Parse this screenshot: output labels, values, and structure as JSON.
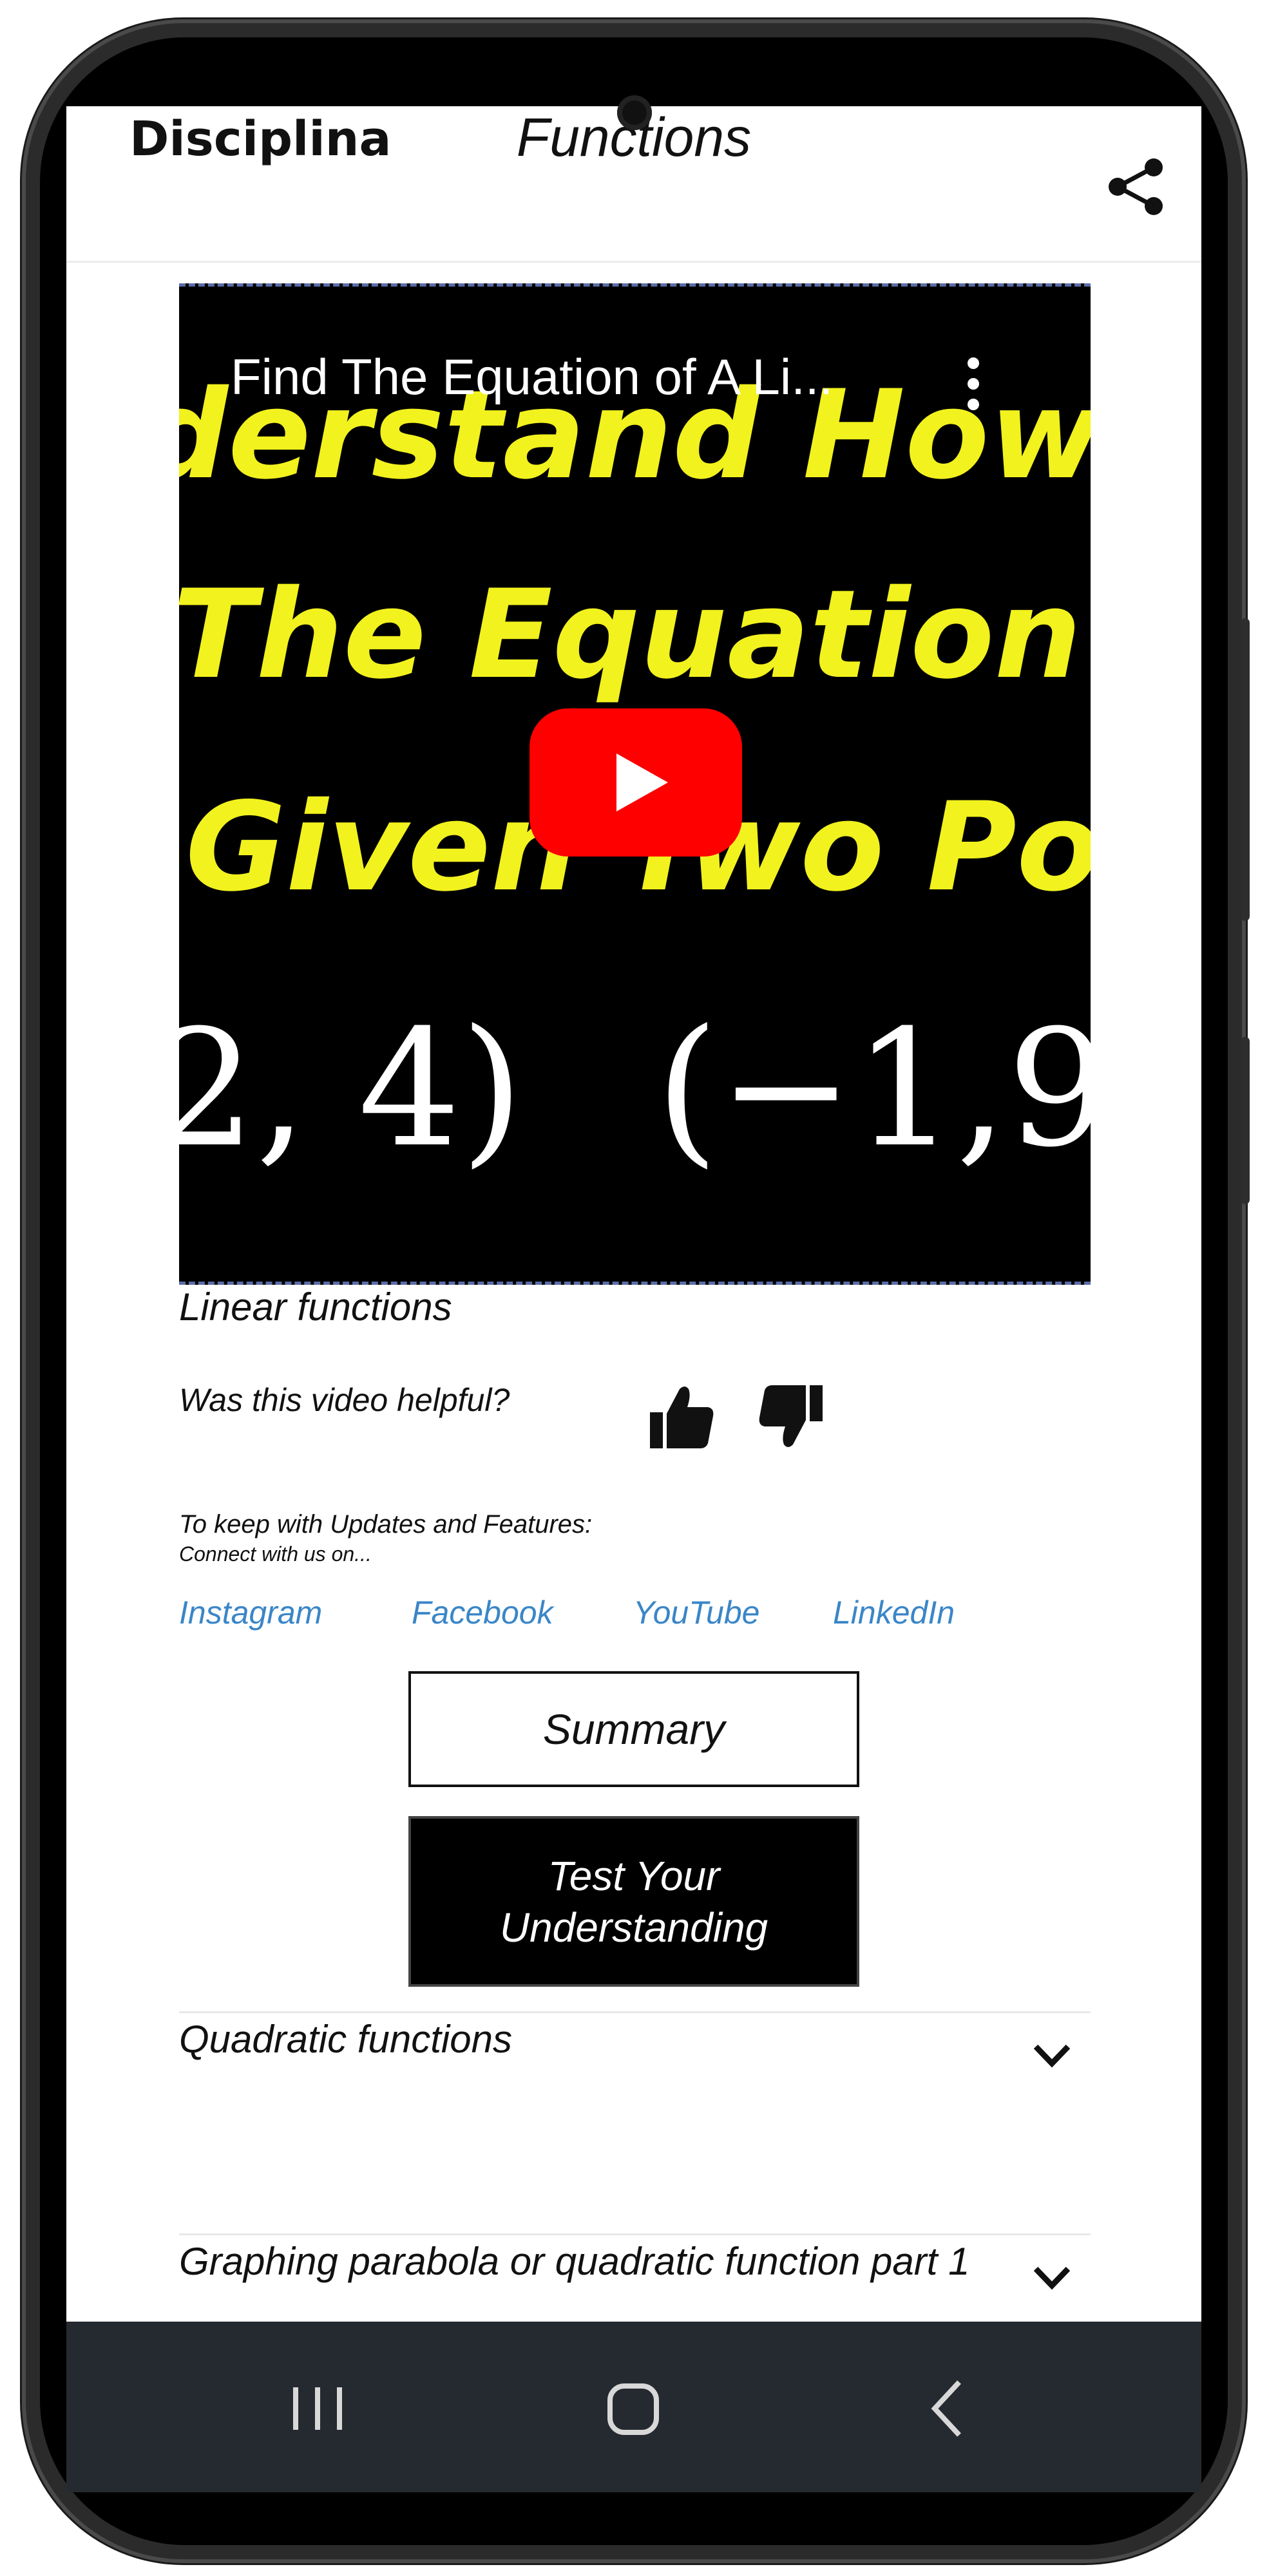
{
  "app": {
    "brand": "Disciplina",
    "title": "Functions"
  },
  "video": {
    "title": "Find The Equation of A Li...",
    "thumbnail_lines": [
      "derstand How",
      "The Equation o",
      "Given Two Po"
    ],
    "thumbnail_math": [
      "2, 4)",
      "(−1,9"
    ],
    "play_icon": "youtube-play-icon"
  },
  "lesson": {
    "title": "Linear functions",
    "helpful_question": "Was this video helpful?",
    "updates_line1": "To keep with Updates and Features:",
    "updates_line2": "Connect with us on...",
    "social": [
      "Instagram",
      "Facebook",
      "YouTube",
      "LinkedIn"
    ],
    "summary_label": "Summary",
    "test_label": "Test Your Understanding"
  },
  "accordions": [
    {
      "title": "Quadratic functions"
    },
    {
      "title": "Graphing parabola or quadratic function part 1"
    }
  ],
  "colors": {
    "link": "#3a86c8",
    "thumbnail_text": "#f2f21e",
    "play_red": "#ff0000",
    "navbar": "#252a30"
  }
}
